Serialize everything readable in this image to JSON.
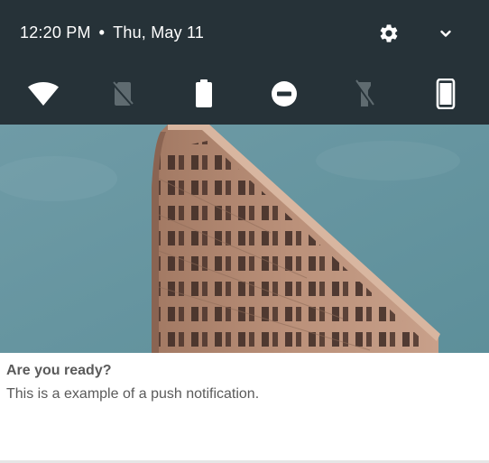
{
  "status_bar": {
    "time": "12:20 PM",
    "separator": "•",
    "date": "Thu, May 11",
    "settings_icon": "gear-icon",
    "expand_icon": "chevron-down-icon"
  },
  "quick_settings": {
    "tiles": [
      {
        "icon": "wifi-icon",
        "state": "on"
      },
      {
        "icon": "no-sim-icon",
        "state": "off"
      },
      {
        "icon": "battery-icon",
        "state": "on"
      },
      {
        "icon": "do-not-disturb-icon",
        "state": "on"
      },
      {
        "icon": "flashlight-off-icon",
        "state": "off"
      },
      {
        "icon": "auto-rotate-icon",
        "state": "on"
      }
    ]
  },
  "notification": {
    "image": "flatiron-building-photo",
    "title": "Are you ready?",
    "body": "This is a example of a push notification."
  },
  "colors": {
    "shade_background": "#263238",
    "icon_active": "#ffffff",
    "icon_inactive": "#5f6b70",
    "notification_text": "#5a5a5a",
    "sky": "#6a97a2"
  }
}
